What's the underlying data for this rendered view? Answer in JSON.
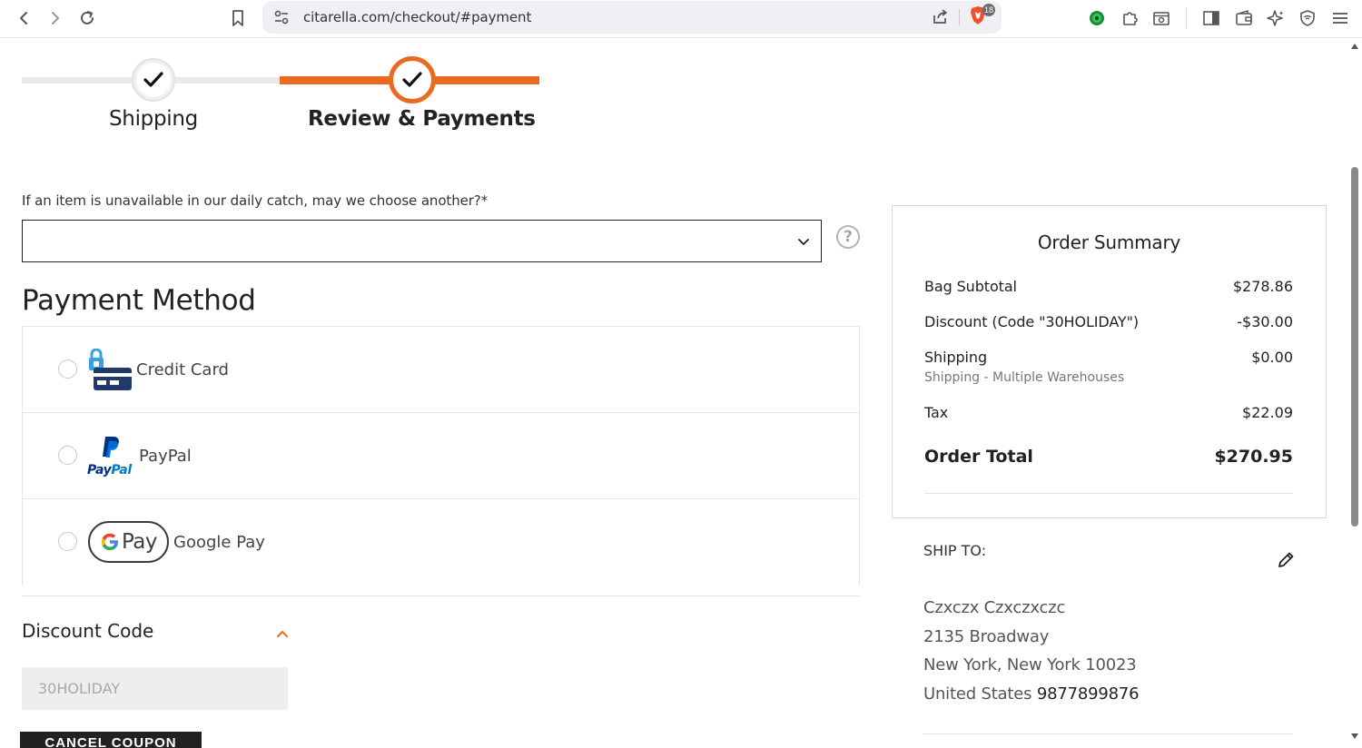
{
  "browser": {
    "url": "citarella.com/checkout/#payment",
    "brave_badge": "18"
  },
  "progress": {
    "steps": [
      {
        "label": "Shipping",
        "state": "complete"
      },
      {
        "label": "Review & Payments",
        "state": "current"
      }
    ],
    "accent_color": "#ec6a1f"
  },
  "substitution": {
    "label": "If an item is unavailable in our daily catch, may we choose another?*",
    "selected_value": ""
  },
  "payment_method": {
    "title": "Payment Method",
    "options": [
      {
        "label": "Credit Card",
        "icon": "credit-card-lock-icon"
      },
      {
        "label": "PayPal",
        "icon": "paypal-logo-icon",
        "logo_text": "PayPal"
      },
      {
        "label": "Google Pay",
        "icon": "google-pay-icon",
        "logo_text": "Pay"
      }
    ]
  },
  "discount": {
    "title": "Discount Code",
    "code_value": "30HOLIDAY",
    "cancel_label": "CANCEL COUPON"
  },
  "order_summary": {
    "title": "Order Summary",
    "bag_subtotal_label": "Bag Subtotal",
    "bag_subtotal_value": "$278.86",
    "discount_label": "Discount (Code \"30HOLIDAY\")",
    "discount_value": "-$30.00",
    "shipping_label": "Shipping",
    "shipping_value": "$0.00",
    "shipping_sub": "Shipping - Multiple Warehouses",
    "tax_label": "Tax",
    "tax_value": "$22.09",
    "total_label": "Order Total",
    "total_value": "$270.95"
  },
  "ship_to": {
    "title": "SHIP TO:",
    "name": "Czxczx Czxczxczc",
    "street": "2135 Broadway",
    "city_line": "New York, New York 10023",
    "country": "United States",
    "phone": "9877899876"
  }
}
